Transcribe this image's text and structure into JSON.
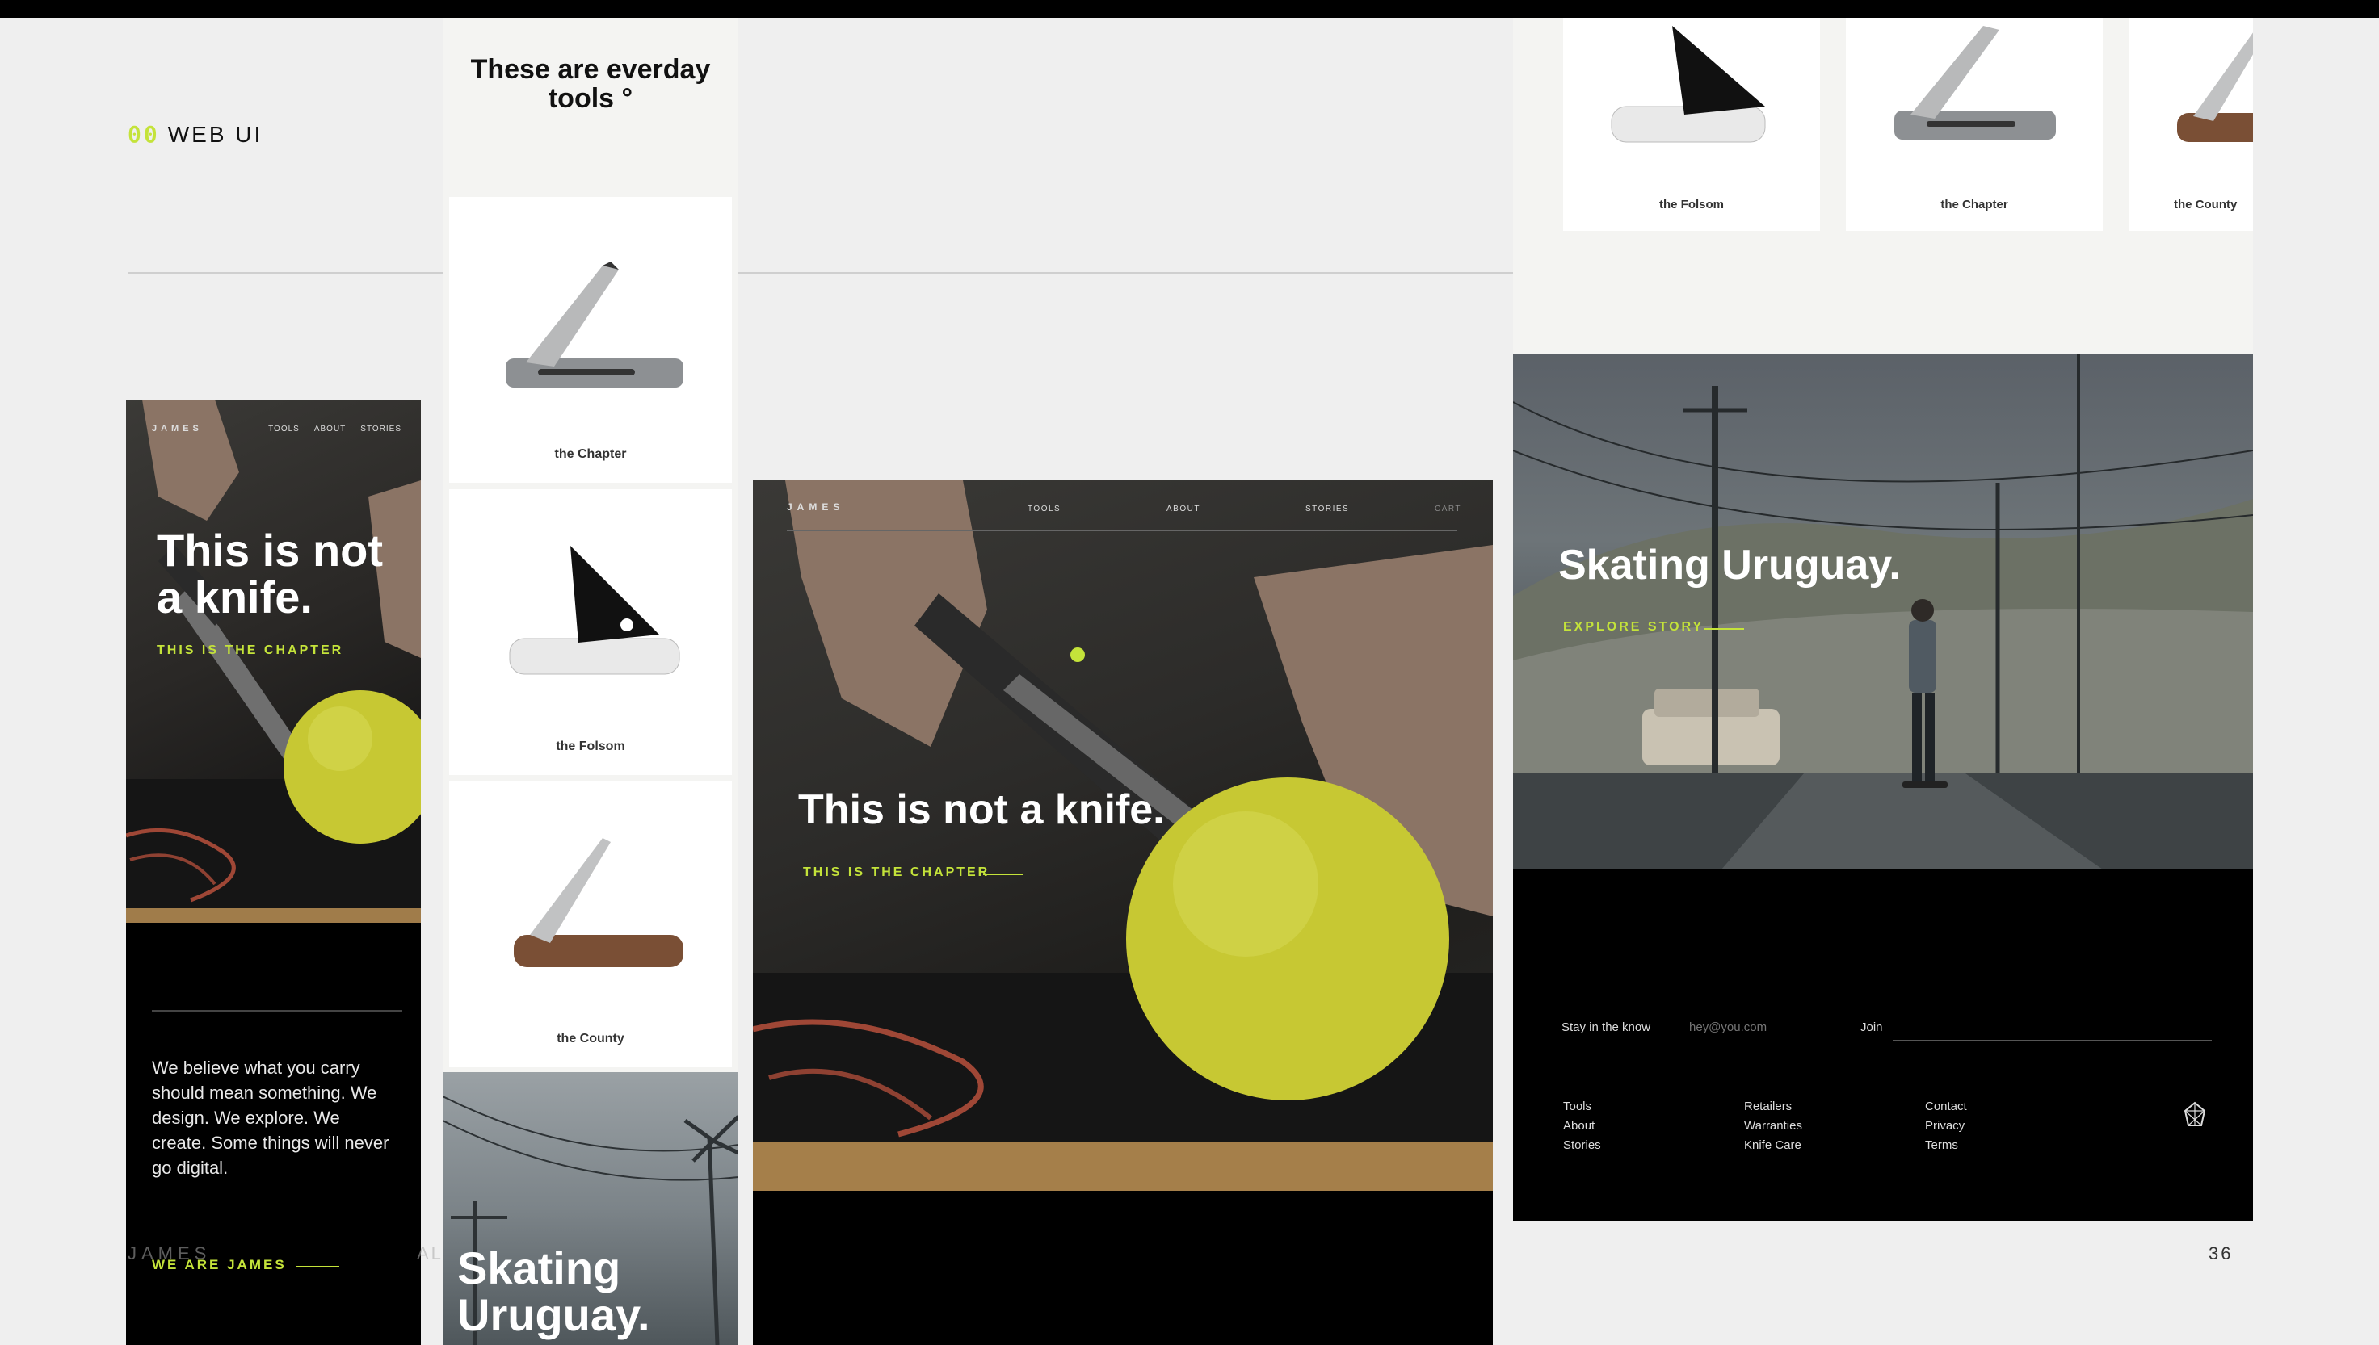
{
  "section": {
    "number": "00",
    "title": "WEB UI"
  },
  "page_number": "36",
  "ghost_text": {
    "left": "JAMES",
    "right": "AL"
  },
  "brand": "JAMES",
  "mobile_home": {
    "nav": [
      "TOOLS",
      "ABOUT",
      "STORIES"
    ],
    "headline": "This is not a knife.",
    "kicker": "THIS IS THE CHAPTER",
    "body": "We believe what you carry should mean something. We design. We explore. We create. Some things will never go digital.",
    "cta": "WE ARE JAMES"
  },
  "mobile_tools": {
    "title": "These are everday tools °",
    "products": [
      "the Chapter",
      "the Folsom",
      "the County"
    ],
    "story_title": "Skating Uruguay."
  },
  "desktop_home": {
    "nav": [
      "TOOLS",
      "ABOUT",
      "STORIES",
      "CART"
    ],
    "headline": "This is not a knife.",
    "kicker": "THIS IS THE CHAPTER"
  },
  "desktop_story": {
    "products": [
      "the Folsom",
      "the Chapter",
      "the County"
    ],
    "story_title": "Skating Uruguay.",
    "explore": "EXPLORE STORY",
    "newsletter": {
      "label": "Stay in the know",
      "placeholder": "hey@you.com",
      "join": "Join"
    },
    "footer_cols": [
      [
        "Tools",
        "About",
        "Stories"
      ],
      [
        "Retailers",
        "Warranties",
        "Knife Care"
      ],
      [
        "Contact",
        "Privacy",
        "Terms"
      ]
    ]
  },
  "colors": {
    "accent": "#c4e33a",
    "dark": "#000000",
    "light_bg": "#efefef"
  },
  "icons": [
    "knife-icon",
    "compass-logo-icon"
  ]
}
